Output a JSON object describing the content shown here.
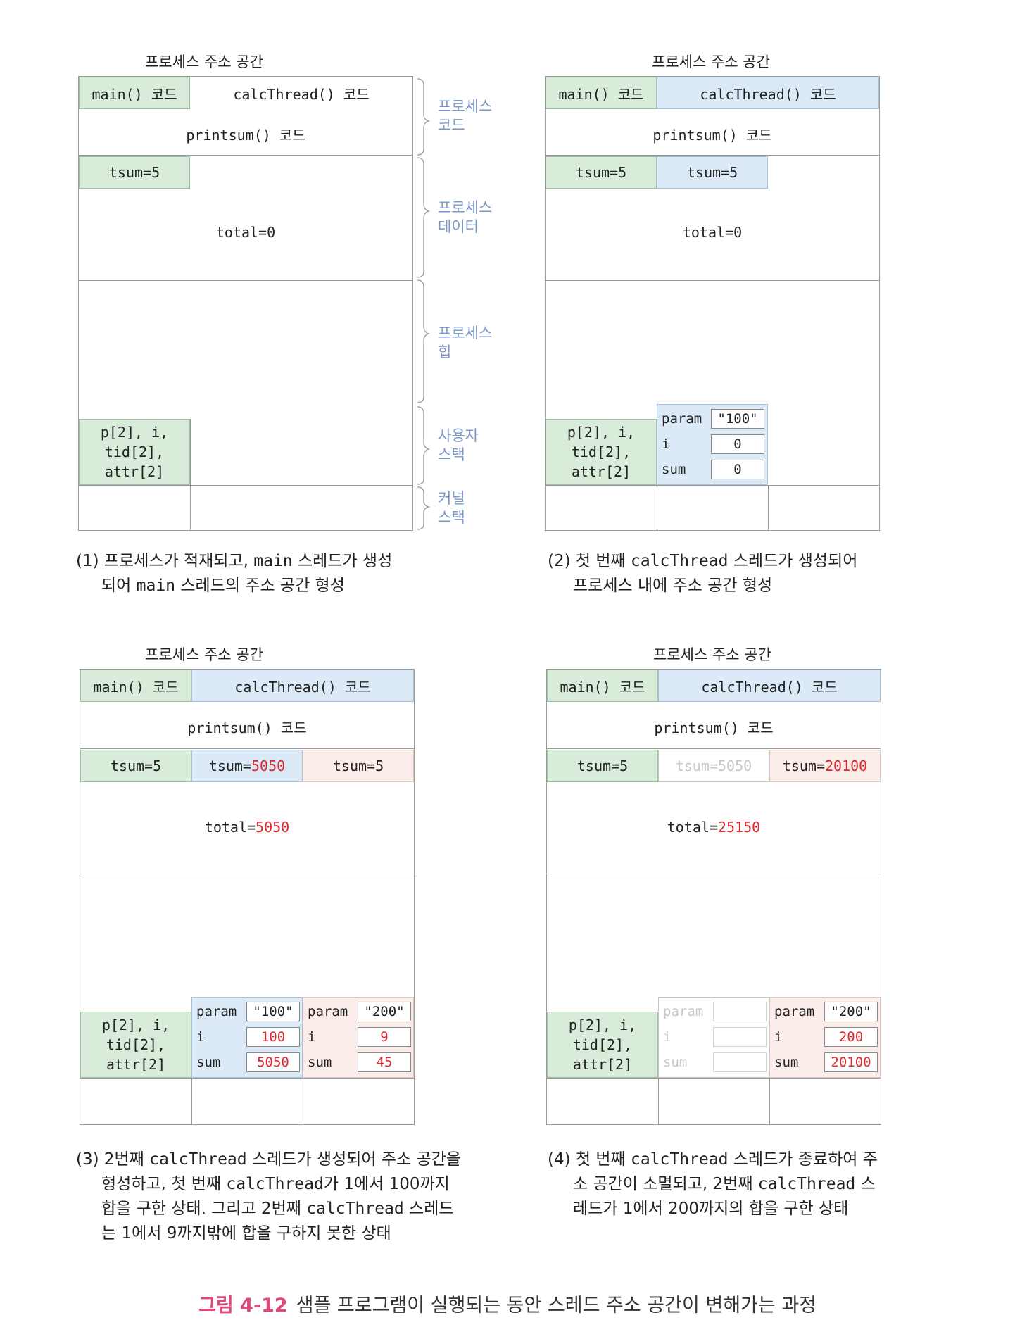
{
  "title": "프로세스 주소 공간",
  "code": {
    "main": "main() 코드",
    "calc": "calcThread() 코드",
    "printsum": "printsum() 코드"
  },
  "vars": {
    "locals": [
      "p[2], i,",
      "tid[2],",
      "attr[2]"
    ],
    "param": "param",
    "i": "i",
    "sum": "sum"
  },
  "segments": {
    "code": [
      "프로세스",
      "코드"
    ],
    "data": [
      "프로세스",
      "데이터"
    ],
    "heap": [
      "프로세스",
      "힙"
    ],
    "ustack": [
      "사용자",
      "스택"
    ],
    "kstack": [
      "커널",
      "스택"
    ]
  },
  "panels": [
    {
      "tsum_main": "tsum=5",
      "total": "total=0",
      "caption": [
        [
          {
            "t": "(1) 프로세스가 적재되고, "
          },
          {
            "t": "main",
            "m": 1
          },
          {
            "t": " 스레드가 생성"
          }
        ],
        [
          {
            "t": "되어 "
          },
          {
            "t": "main",
            "m": 1
          },
          {
            "t": " 스레드의 주소 공간 형성"
          }
        ]
      ]
    },
    {
      "tsum_main": "tsum=5",
      "tsum_t1": "tsum=5",
      "total": "total=0",
      "t1": {
        "param": "\"100\"",
        "i": "0",
        "sum": "0"
      },
      "caption": [
        [
          {
            "t": "(2) 첫 번째 "
          },
          {
            "t": "calcThread",
            "m": 1
          },
          {
            "t": " 스레드가 생성되어"
          }
        ],
        [
          {
            "t": "프로세스 내에 주소 공간 형성"
          }
        ]
      ]
    },
    {
      "tsum_main": "tsum=5",
      "tsum_t1_label": "tsum=",
      "tsum_t1_value": "5050",
      "tsum_t2": "tsum=5",
      "total_label": "total=",
      "total_value": "5050",
      "t1": {
        "param": "\"100\"",
        "i": "100",
        "sum": "5050"
      },
      "t2": {
        "param": "\"200\"",
        "i": "9",
        "sum": "45"
      },
      "caption": [
        [
          {
            "t": "(3) 2번째 "
          },
          {
            "t": "calcThread",
            "m": 1
          },
          {
            "t": " 스레드가 생성되어 주소 공간을"
          }
        ],
        [
          {
            "t": "형성하고, 첫 번째 "
          },
          {
            "t": "calcThread",
            "m": 1
          },
          {
            "t": "가 1에서 100까지"
          }
        ],
        [
          {
            "t": "합을 구한 상태. 그리고 2번째 "
          },
          {
            "t": "calcThread",
            "m": 1
          },
          {
            "t": " 스레드"
          }
        ],
        [
          {
            "t": "는 1에서 9까지밖에 합을 구하지 못한 상태"
          }
        ]
      ]
    },
    {
      "tsum_main": "tsum=5",
      "tsum_t1_faded": "tsum=5050",
      "tsum_t2_label": "tsum=",
      "tsum_t2_value": "20100",
      "total_label": "total=",
      "total_value": "25150",
      "t2": {
        "param": "\"200\"",
        "i": "200",
        "sum": "20100"
      },
      "caption": [
        [
          {
            "t": "(4) 첫 번째 "
          },
          {
            "t": "calcThread",
            "m": 1
          },
          {
            "t": " 스레드가 종료하여 주"
          }
        ],
        [
          {
            "t": "소 공간이 소멸되고, 2번째 "
          },
          {
            "t": "calcThread",
            "m": 1
          },
          {
            "t": " 스"
          }
        ],
        [
          {
            "t": "레드가 1에서 200까지의 합을 구한 상태"
          }
        ]
      ]
    }
  ],
  "figure": {
    "number": "그림 4-12",
    "text": "샘플 프로그램이 실행되는 동안 스레드 주소 공간이 변해가는 과정"
  }
}
